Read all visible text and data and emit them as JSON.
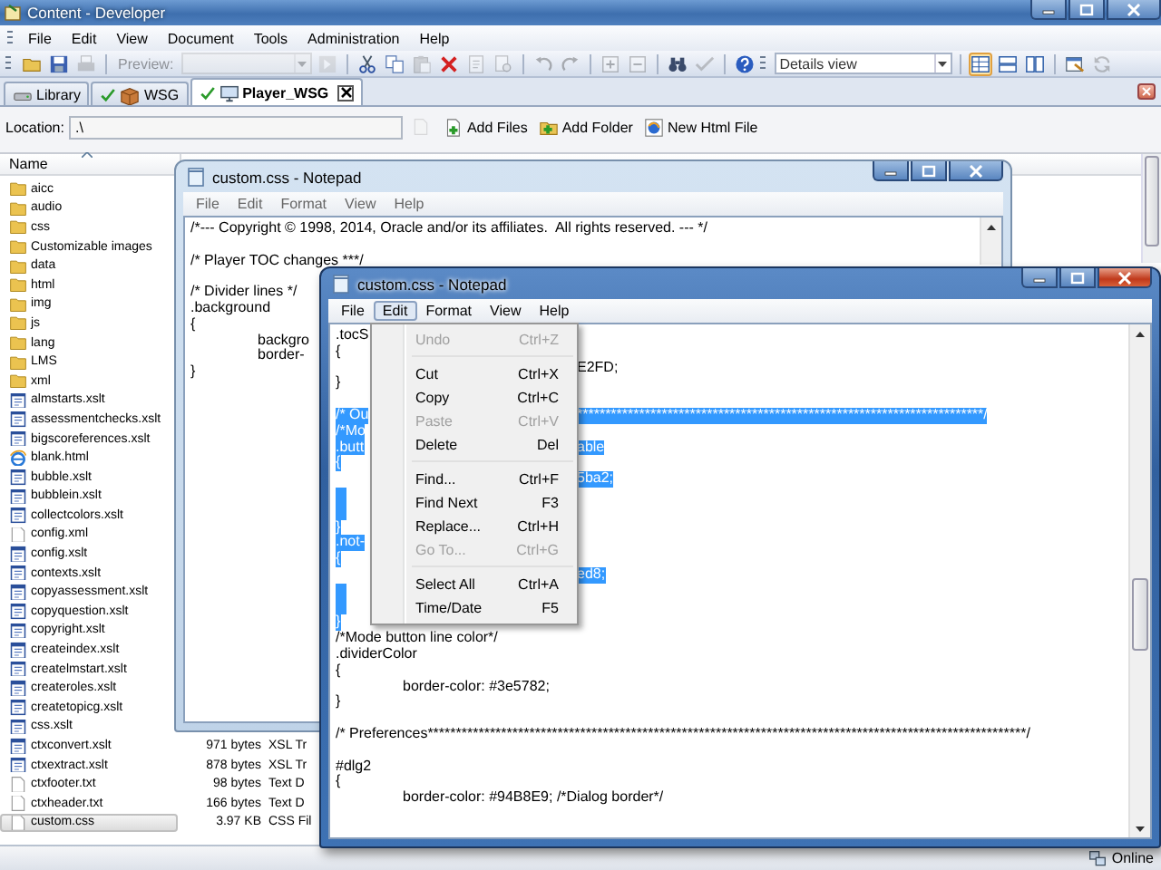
{
  "window": {
    "title": "Content - Developer"
  },
  "menu": [
    "File",
    "Edit",
    "View",
    "Document",
    "Tools",
    "Administration",
    "Help"
  ],
  "toolbar": [
    {
      "kind": "open",
      "disabled": false
    },
    {
      "kind": "save",
      "disabled": false
    },
    {
      "kind": "print",
      "disabled": true
    },
    {
      "kind": "separator"
    },
    {
      "kind": "label",
      "text": "Preview:",
      "disabled": true
    },
    {
      "kind": "combo",
      "disabled": true
    },
    {
      "kind": "go",
      "disabled": true
    },
    {
      "kind": "separator"
    },
    {
      "kind": "cut",
      "disabled": false
    },
    {
      "kind": "copy",
      "disabled": false
    },
    {
      "kind": "paste",
      "disabled": true
    },
    {
      "kind": "delete",
      "disabled": false
    },
    {
      "kind": "checkout",
      "disabled": true
    },
    {
      "kind": "checkin",
      "disabled": true
    },
    {
      "kind": "separator"
    },
    {
      "kind": "undo",
      "disabled": true
    },
    {
      "kind": "redo",
      "disabled": true
    },
    {
      "kind": "separator"
    },
    {
      "kind": "expand",
      "disabled": true
    },
    {
      "kind": "collapse",
      "disabled": true
    },
    {
      "kind": "separator"
    },
    {
      "kind": "find",
      "disabled": false
    },
    {
      "kind": "spell",
      "disabled": true
    },
    {
      "kind": "separator"
    },
    {
      "kind": "help",
      "disabled": false
    },
    {
      "kind": "gripper"
    },
    {
      "kind": "combo",
      "value": "Details view",
      "disabled": false
    },
    {
      "kind": "separator"
    },
    {
      "kind": "view_details",
      "selected": true,
      "disabled": false
    },
    {
      "kind": "view_list",
      "selected": false,
      "disabled": false
    },
    {
      "kind": "view_split",
      "selected": false,
      "disabled": false
    },
    {
      "kind": "separator"
    },
    {
      "kind": "properties",
      "disabled": false
    },
    {
      "kind": "refresh",
      "disabled": true
    }
  ],
  "tabs": [
    {
      "label": "Library",
      "kind": "library",
      "checked_out": false,
      "closable": false,
      "selected": false
    },
    {
      "label": "WSG",
      "kind": "package",
      "checked_out": true,
      "closable": false,
      "selected": false
    },
    {
      "label": "Player_WSG",
      "kind": "player",
      "checked_out": true,
      "closable": true,
      "selected": true
    }
  ],
  "location": {
    "label": "Location:",
    "value": ".\\",
    "up_disabled": true,
    "actions": [
      {
        "label": "Add Files",
        "kind": "add_files"
      },
      {
        "label": "Add Folder",
        "kind": "add_folder"
      },
      {
        "label": "New Html File",
        "kind": "new_html"
      }
    ]
  },
  "list": {
    "columns": [
      {
        "label": "Name",
        "sorted": true
      }
    ],
    "files": [
      {
        "name": "aicc",
        "kind": "folder",
        "selected": false
      },
      {
        "name": "audio",
        "kind": "folder",
        "selected": false
      },
      {
        "name": "css",
        "kind": "folder",
        "selected": false
      },
      {
        "name": "Customizable images",
        "kind": "folder",
        "selected": false
      },
      {
        "name": "data",
        "kind": "folder",
        "selected": false
      },
      {
        "name": "html",
        "kind": "folder",
        "selected": false
      },
      {
        "name": "img",
        "kind": "folder",
        "selected": false
      },
      {
        "name": "js",
        "kind": "folder",
        "selected": false
      },
      {
        "name": "lang",
        "kind": "folder",
        "selected": false
      },
      {
        "name": "LMS",
        "kind": "folder",
        "selected": false
      },
      {
        "name": "xml",
        "kind": "folder",
        "selected": false
      },
      {
        "name": "almstarts.xslt",
        "kind": "xslt",
        "selected": false
      },
      {
        "name": "assessmentchecks.xslt",
        "kind": "xslt",
        "selected": false
      },
      {
        "name": "bigscoreferences.xslt",
        "kind": "xslt",
        "selected": false
      },
      {
        "name": "blank.html",
        "kind": "html",
        "selected": false
      },
      {
        "name": "bubble.xslt",
        "kind": "xslt",
        "selected": false
      },
      {
        "name": "bubblein.xslt",
        "kind": "xslt",
        "selected": false
      },
      {
        "name": "collectcolors.xslt",
        "kind": "xslt",
        "selected": false
      },
      {
        "name": "config.xml",
        "kind": "text",
        "selected": false
      },
      {
        "name": "config.xslt",
        "kind": "xslt",
        "selected": false
      },
      {
        "name": "contexts.xslt",
        "kind": "xslt",
        "selected": false
      },
      {
        "name": "copyassessment.xslt",
        "kind": "xslt",
        "selected": false
      },
      {
        "name": "copyquestion.xslt",
        "kind": "xslt",
        "selected": false
      },
      {
        "name": "copyright.xslt",
        "kind": "xslt",
        "selected": false
      },
      {
        "name": "createindex.xslt",
        "kind": "xslt",
        "selected": false
      },
      {
        "name": "createlmstart.xslt",
        "kind": "xslt",
        "selected": false
      },
      {
        "name": "createroles.xslt",
        "kind": "xslt",
        "selected": false
      },
      {
        "name": "createtopicg.xslt",
        "kind": "xslt",
        "selected": false
      },
      {
        "name": "css.xslt",
        "kind": "xslt",
        "selected": false
      },
      {
        "name": "ctxconvert.xslt",
        "kind": "xslt",
        "selected": false,
        "size": "971 bytes",
        "type": "XSL Tr"
      },
      {
        "name": "ctxextract.xslt",
        "kind": "xslt",
        "selected": false,
        "size": "878 bytes",
        "type": "XSL Tr"
      },
      {
        "name": "ctxfooter.txt",
        "kind": "text",
        "selected": false,
        "size": "98 bytes",
        "type": "Text D"
      },
      {
        "name": "ctxheader.txt",
        "kind": "text",
        "selected": false,
        "size": "166 bytes",
        "type": "Text D"
      },
      {
        "name": "custom.css",
        "kind": "text",
        "selected": true,
        "size": "3.97 KB",
        "type": "CSS Fil"
      }
    ]
  },
  "notepads": [
    {
      "title": "custom.css - Notepad",
      "active": false,
      "menu": [
        {
          "label": "File",
          "open": false
        },
        {
          "label": "Edit",
          "open": false
        },
        {
          "label": "Format",
          "open": false
        },
        {
          "label": "View",
          "open": false
        },
        {
          "label": "Help",
          "open": false
        }
      ],
      "lines": [
        {
          "kind": "text",
          "text": "/*--- Copyright © 1998, 2014, Oracle and/or its affiliates.  All rights reserved. --- */",
          "selected": false
        },
        {
          "kind": "blank",
          "selected": false
        },
        {
          "kind": "text",
          "text": "/* Player TOC changes ***/",
          "selected": false
        },
        {
          "kind": "blank",
          "selected": false
        },
        {
          "kind": "text",
          "text": "/* Divider lines */",
          "selected": false
        },
        {
          "kind": "text",
          "text": ".background",
          "selected": false
        },
        {
          "kind": "text",
          "text": "{",
          "selected": false
        },
        {
          "kind": "text",
          "text": "\tbackgro",
          "selected": false
        },
        {
          "kind": "text",
          "text": "\tborder-",
          "selected": false
        },
        {
          "kind": "text",
          "text": "}",
          "selected": false
        }
      ]
    },
    {
      "title": "custom.css - Notepad",
      "active": true,
      "menu": [
        {
          "label": "File",
          "open": false
        },
        {
          "label": "Edit",
          "open": true
        },
        {
          "label": "Format",
          "open": false
        },
        {
          "label": "View",
          "open": false
        },
        {
          "label": "Help",
          "open": false
        }
      ],
      "edit_menu": [
        {
          "kind": "item",
          "label": "Undo",
          "shortcut": "Ctrl+Z",
          "disabled": true
        },
        {
          "kind": "separator"
        },
        {
          "kind": "item",
          "label": "Cut",
          "shortcut": "Ctrl+X",
          "disabled": false
        },
        {
          "kind": "item",
          "label": "Copy",
          "shortcut": "Ctrl+C",
          "disabled": false
        },
        {
          "kind": "item",
          "label": "Paste",
          "shortcut": "Ctrl+V",
          "disabled": true
        },
        {
          "kind": "item",
          "label": "Delete",
          "shortcut": "Del",
          "disabled": false
        },
        {
          "kind": "separator"
        },
        {
          "kind": "item",
          "label": "Find...",
          "shortcut": "Ctrl+F",
          "disabled": false
        },
        {
          "kind": "item",
          "label": "Find Next",
          "shortcut": "F3",
          "disabled": false
        },
        {
          "kind": "item",
          "label": "Replace...",
          "shortcut": "Ctrl+H",
          "disabled": false
        },
        {
          "kind": "item",
          "label": "Go To...",
          "shortcut": "Ctrl+G",
          "disabled": true
        },
        {
          "kind": "separator"
        },
        {
          "kind": "item",
          "label": "Select All",
          "shortcut": "Ctrl+A",
          "disabled": false
        },
        {
          "kind": "item",
          "label": "Time/Date",
          "shortcut": "F5",
          "disabled": false
        }
      ],
      "lines": [
        {
          "kind": "text",
          "text": ".tocS",
          "selected": false
        },
        {
          "kind": "text",
          "text": "{",
          "selected": false
        },
        {
          "kind": "text",
          "text_right": "E2FD;",
          "selected": false
        },
        {
          "kind": "text",
          "text": "}",
          "selected": false
        },
        {
          "kind": "blank",
          "selected": false
        },
        {
          "kind": "text",
          "text": "/* Ou",
          "text_right": "************************************************************************/",
          "selected": true
        },
        {
          "kind": "text",
          "text": "/*Mo",
          "selected": true
        },
        {
          "kind": "text",
          "text": ".butt",
          "text_right": "able",
          "selected": true
        },
        {
          "kind": "text",
          "text": "{",
          "selected": true
        },
        {
          "kind": "text",
          "text_right": "5ba2;",
          "selected": true
        },
        {
          "kind": "blank",
          "selected": true
        },
        {
          "kind": "blank",
          "selected": true
        },
        {
          "kind": "text",
          "text": "}",
          "selected": true
        },
        {
          "kind": "text",
          "text": ".not-",
          "selected": true
        },
        {
          "kind": "text",
          "text": "{",
          "selected": true
        },
        {
          "kind": "text",
          "text_right": "ed8;",
          "selected": true
        },
        {
          "kind": "blank",
          "selected": true
        },
        {
          "kind": "blank",
          "selected": true
        },
        {
          "kind": "text",
          "text": "}",
          "selected": true
        },
        {
          "kind": "text",
          "text": "/*Mode button line color*/",
          "selected": false
        },
        {
          "kind": "text",
          "text": ".dividerColor",
          "selected": false
        },
        {
          "kind": "text",
          "text": "{",
          "selected": false
        },
        {
          "kind": "text",
          "text": "\tborder-color: #3e5782;",
          "selected": false
        },
        {
          "kind": "text",
          "text": "}",
          "selected": false
        },
        {
          "kind": "blank",
          "selected": false
        },
        {
          "kind": "text",
          "text": "/* Preferences**********************************************************************************************************/",
          "selected": false
        },
        {
          "kind": "blank",
          "selected": false
        },
        {
          "kind": "text",
          "text": "#dlg2",
          "selected": false
        },
        {
          "kind": "text",
          "text": "{",
          "selected": false
        },
        {
          "kind": "text",
          "text": "\tborder-color: #94B8E9; /*Dialog border*/",
          "selected": false
        }
      ]
    }
  ],
  "status_bar": {
    "text": "Online"
  }
}
